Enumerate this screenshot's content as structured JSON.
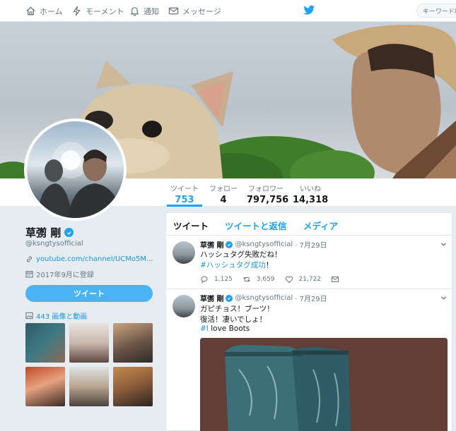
{
  "nav": {
    "home": "ホーム",
    "moments": "モーメント",
    "notifications": "通知",
    "messages": "メッセージ",
    "search_placeholder": "キーワード検索"
  },
  "colors": {
    "accent": "#1da1f2",
    "link": "#1b95e0",
    "muted": "#657786",
    "background": "#e6ecf0"
  },
  "stats": [
    {
      "label": "ツイート",
      "value": "753"
    },
    {
      "label": "フォロー",
      "value": "4"
    },
    {
      "label": "フォロワー",
      "value": "797,756"
    },
    {
      "label": "いいね",
      "value": "14,318"
    }
  ],
  "profile": {
    "name": "草彅 剛",
    "handle": "@ksngtysofficial",
    "link": "youtube.com/channel/UCMo5M...",
    "joined": "2017年9月に登録",
    "tweet_button": "ツイート",
    "media_label": "443 画像と動画"
  },
  "tabs": [
    "ツイート",
    "ツイートと返信",
    "メディア"
  ],
  "tweets": [
    {
      "name": "草彅 剛",
      "handle": "@ksngtysofficial",
      "date": "· 7月29日",
      "line1": "ハッシュタグ失敗だね！",
      "line2_tag": "#ハッシュタグ成功",
      "line2_tail": "！",
      "replies": "1,125",
      "retweets": "3,659",
      "likes": "21,722"
    },
    {
      "name": "草彅 剛",
      "handle": "@ksngtysofficial",
      "date": "· 7月29日",
      "line1": "ガピチョス！ブーツ！",
      "line2": "復活！凄いでしょ！",
      "line3_tag": "#I",
      "line3_tail": " love Boots"
    }
  ],
  "icons": [
    "home-icon",
    "lightning-icon",
    "bell-icon",
    "envelope-icon",
    "twitter-bird-icon",
    "verified-icon",
    "link-icon",
    "calendar-icon",
    "image-icon",
    "reply-icon",
    "retweet-icon",
    "like-icon",
    "dm-icon",
    "chevron-down-icon"
  ]
}
